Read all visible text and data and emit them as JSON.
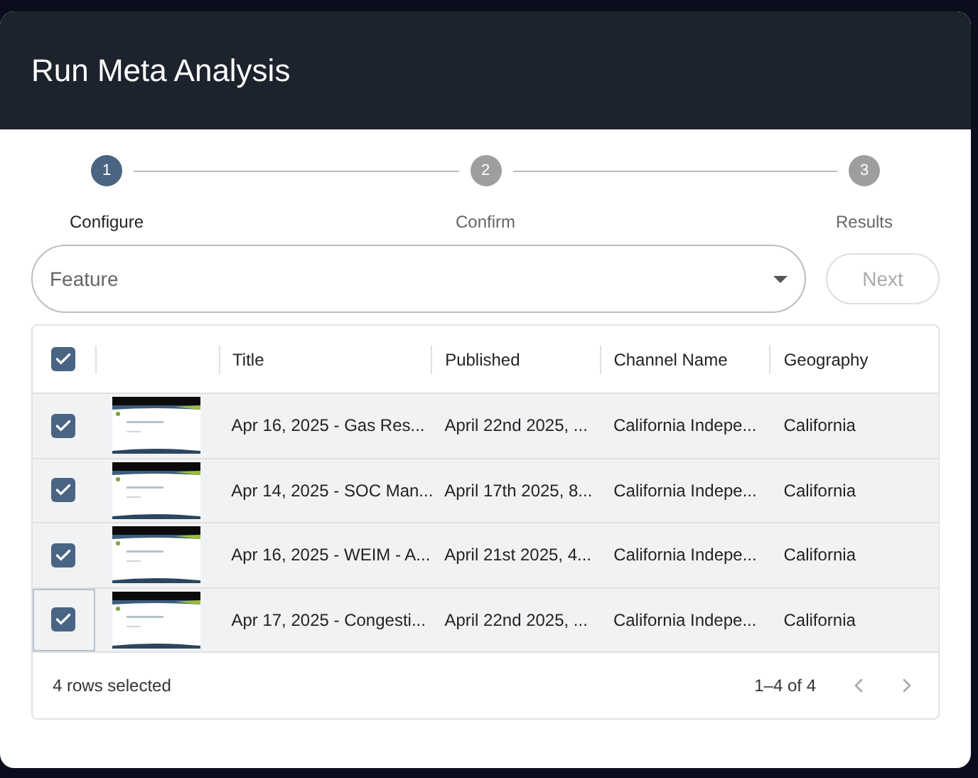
{
  "dialog": {
    "title": "Run Meta Analysis"
  },
  "steps": [
    {
      "number": "1",
      "label": "Configure",
      "selected": true
    },
    {
      "number": "2",
      "label": "Confirm",
      "selected": false
    },
    {
      "number": "3",
      "label": "Results",
      "selected": false
    }
  ],
  "feature_select": {
    "placeholder": "Feature"
  },
  "next_button": {
    "label": "Next",
    "disabled": true
  },
  "table": {
    "all_checked": true,
    "columns": [
      "Title",
      "Published",
      "Channel Name",
      "Geography"
    ],
    "rows": [
      {
        "checked": true,
        "focused": false,
        "cells": [
          "Apr 16, 2025 - Gas Res...",
          "April 22nd 2025, ...",
          "California Indepe...",
          "California"
        ]
      },
      {
        "checked": true,
        "focused": false,
        "cells": [
          "Apr 14, 2025 - SOC Man...",
          "April 17th 2025, 8...",
          "California Indepe...",
          "California"
        ]
      },
      {
        "checked": true,
        "focused": false,
        "cells": [
          "Apr 16, 2025 - WEIM - A...",
          "April 21st 2025, 4...",
          "California Indepe...",
          "California"
        ]
      },
      {
        "checked": true,
        "focused": true,
        "cells": [
          "Apr 17, 2025 - Congesti...",
          "April 22nd 2025, ...",
          "California Indepe...",
          "California"
        ]
      }
    ],
    "footer": {
      "selection": "4 rows selected",
      "range": "1–4 of 4"
    }
  }
}
